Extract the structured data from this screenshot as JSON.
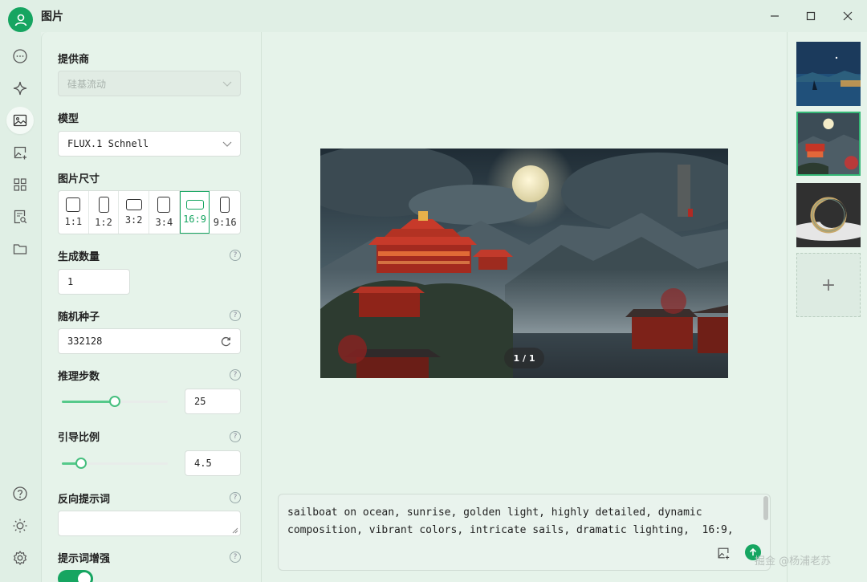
{
  "window": {
    "title": "图片"
  },
  "sidebar_icons": [
    "chat-icon",
    "sparkle-icon",
    "image-icon",
    "image-edit-icon",
    "apps-grid-icon",
    "document-search-icon",
    "folder-icon",
    "help-icon",
    "theme-icon",
    "settings-icon"
  ],
  "settings": {
    "provider": {
      "label": "提供商",
      "value": "硅基流动"
    },
    "model": {
      "label": "模型",
      "value": "FLUX.1 Schnell"
    },
    "size": {
      "label": "图片尺寸",
      "options": [
        "1:1",
        "1:2",
        "3:2",
        "3:4",
        "16:9",
        "9:16"
      ],
      "selected": "16:9"
    },
    "count": {
      "label": "生成数量",
      "value": "1"
    },
    "seed": {
      "label": "随机种子",
      "value": "332128"
    },
    "steps": {
      "label": "推理步数",
      "value": "25",
      "slider_fraction": 0.5
    },
    "guidance": {
      "label": "引导比例",
      "value": "4.5",
      "slider_fraction": 0.18
    },
    "negative_prompt": {
      "label": "反向提示词",
      "value": ""
    },
    "prompt_enhance": {
      "label": "提示词增强",
      "enabled": true
    }
  },
  "preview": {
    "pager": "1 / 1"
  },
  "prompt": {
    "text": "sailboat on ocean, sunrise, golden light, highly detailed, dynamic composition, vibrant colors, intricate sails, dramatic lighting,  16:9,"
  },
  "gallery": {
    "add_label": "+"
  },
  "watermark": "掘金 @杨浦老苏",
  "colors": {
    "accent": "#16a561",
    "background": "#e6f3ea"
  }
}
